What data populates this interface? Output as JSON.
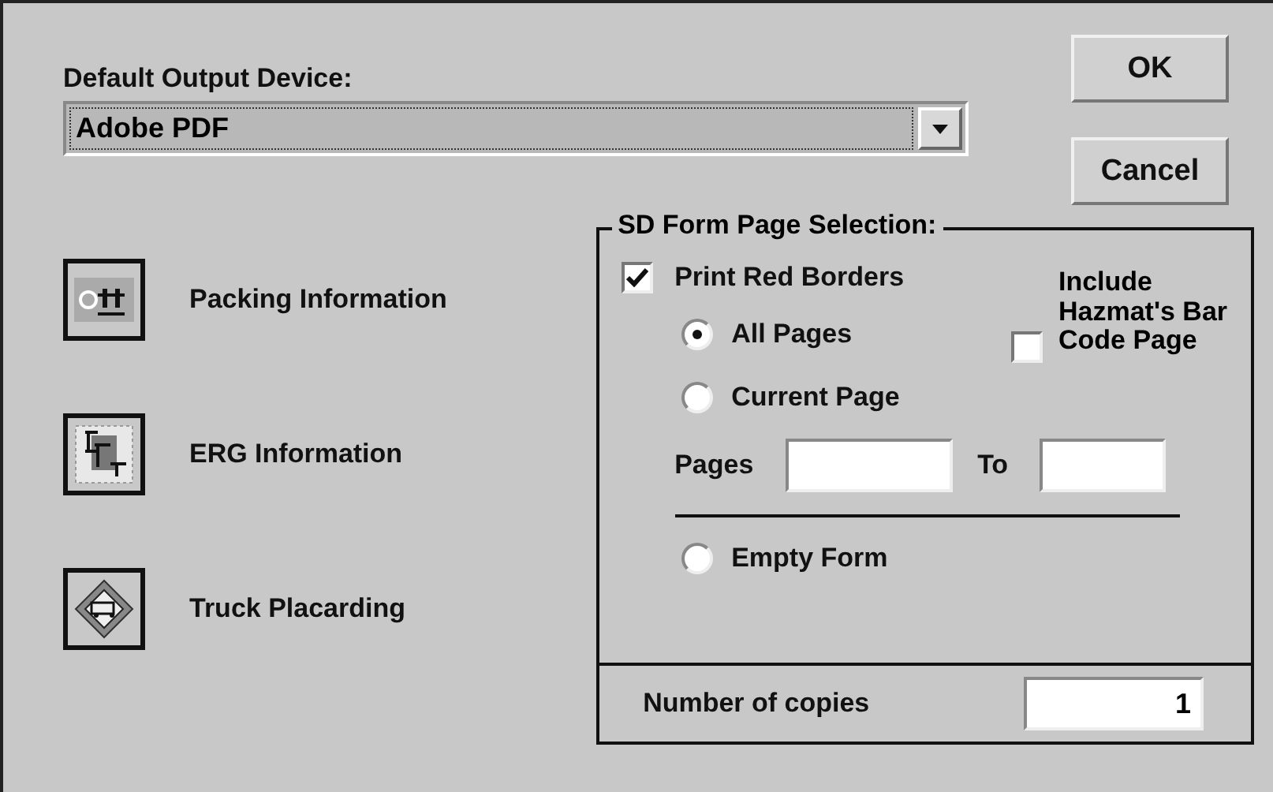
{
  "dropdown": {
    "label": "Default Output Device:",
    "value": "Adobe PDF"
  },
  "buttons": [
    "OK",
    "Cancel"
  ],
  "tools": [
    {
      "label": "Packing Information",
      "kind": "packing"
    },
    {
      "label": "ERG Information",
      "kind": "erg"
    },
    {
      "label": "Truck Placarding",
      "kind": "truck"
    }
  ],
  "page_selection": {
    "title": "SD Form Page Selection:",
    "print_red_borders": {
      "label": "Print Red Borders",
      "checked": true
    },
    "include_barcode": {
      "label": "Include Hazmat's Bar Code Page",
      "checked": false
    },
    "options": [
      {
        "label": "All Pages",
        "selected": true
      },
      {
        "label": "Current Page",
        "selected": false
      },
      {
        "label": "Empty Form",
        "selected": false
      }
    ],
    "range": {
      "from_label": "Pages",
      "to_label": "To"
    }
  },
  "copies": {
    "label": "Number of copies",
    "value": "1"
  }
}
